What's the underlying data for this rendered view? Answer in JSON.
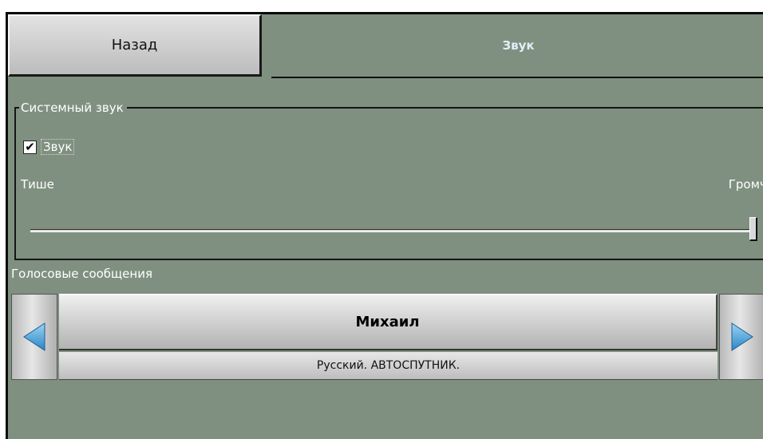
{
  "header": {
    "back_label": "Назад",
    "title": "Звук"
  },
  "system_sound": {
    "group_title": "Системный звук",
    "sound_checkbox": {
      "label": "Звук",
      "checked": true
    },
    "quieter_label": "Тише",
    "louder_label": "Громче",
    "volume_level_fraction": 1.0
  },
  "voice": {
    "section_label": "Голосовые сообщения",
    "selected_voice_name": "Михаил",
    "selected_voice_description": "Русский. АВТОСПУТНИК."
  },
  "colors": {
    "background": "#7f9080",
    "title_text": "#dfeefa",
    "arrow": "#4aa6dd"
  },
  "icons": {
    "prev": "triangle-left-icon",
    "next": "triangle-right-icon",
    "check": "checkmark-icon"
  }
}
